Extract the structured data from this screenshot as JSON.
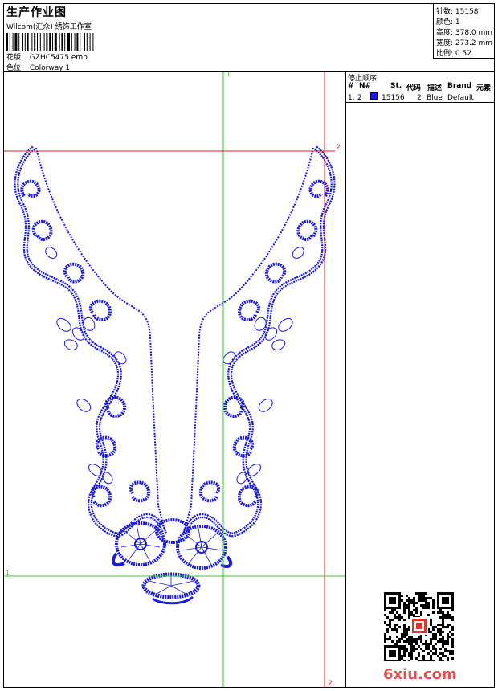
{
  "header": {
    "title": "生产作业图",
    "studio": "Wilcom(汇众) 绣饰工作室",
    "design_label": "花版:",
    "design_value": "GZHC5475.emb",
    "colorway_label": "色位:",
    "colorway_value": "Colorway 1"
  },
  "stats": {
    "stitches": "针数: 15158",
    "colors": "颜色: 1",
    "height": "高度: 378.0 mm",
    "width": "宽度: 273.2 mm",
    "scale": "比例: 0.52"
  },
  "stop_sequence": {
    "title": "停止顺序:",
    "headers": {
      "hash": "#",
      "no": "N#",
      "st": "St.",
      "code": "代码",
      "desc": "描述",
      "brand": "Brand",
      "element": "元素"
    },
    "row": {
      "index": "1.",
      "needle": "2",
      "stitches": "15156",
      "code": "2",
      "desc": "Blue",
      "brand": "Default"
    }
  },
  "guides": {
    "v1_label": "1",
    "h1_label": "1",
    "h2_label": "2",
    "v2_label": "2"
  },
  "watermark": "6xiu.com",
  "colors": {
    "thread": "#1a1adc",
    "guide_green": "#33cc33",
    "guide_red": "#dd2222",
    "watermark": "#e05050"
  }
}
